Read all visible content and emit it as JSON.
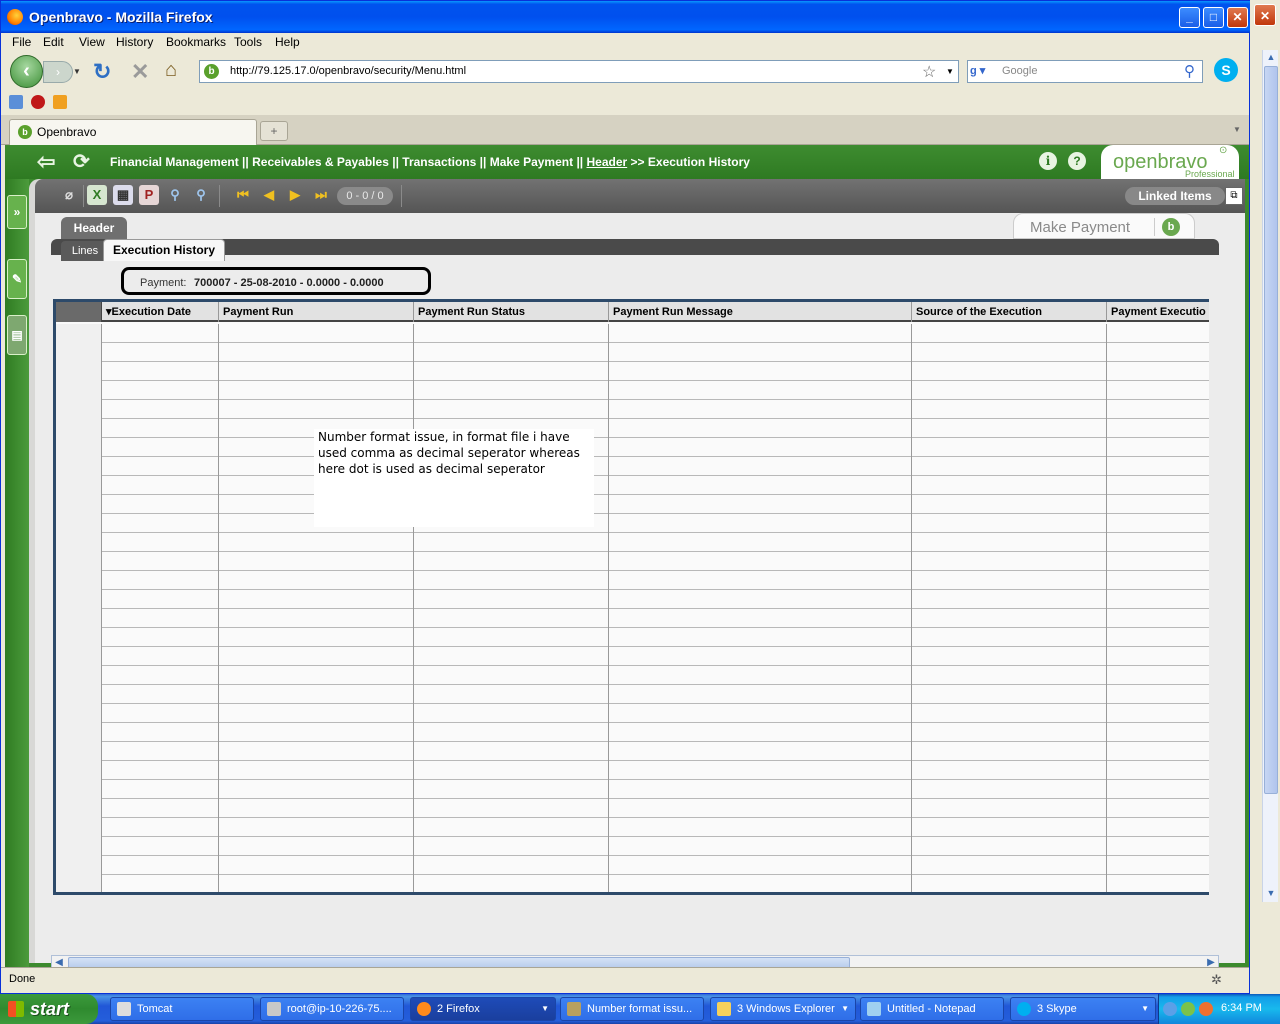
{
  "browser": {
    "title": "Openbravo - Mozilla Firefox",
    "menu": [
      "File",
      "Edit",
      "View",
      "History",
      "Bookmarks",
      "Tools",
      "Help"
    ],
    "url": "http://79.125.17.0/openbravo/security/Menu.html",
    "search_placeholder": "Google",
    "tab_label": "Openbravo",
    "new_tab_symbol": "+",
    "status": "Done"
  },
  "breadcrumb": {
    "part1": "Financial Management",
    "part2": "Receivables & Payables",
    "part3": "Transactions",
    "part4": "Make Payment",
    "header_link": "Header",
    "current": "Execution History",
    "sep": "||",
    "arrow": ">>"
  },
  "logo": {
    "main": "openbravo",
    "sub": "Professional"
  },
  "toolbar": {
    "record_counter": "0 - 0 / 0",
    "linked_items": "Linked Items"
  },
  "window": {
    "header_tab": "Header",
    "title_tab": "Make Payment",
    "subtabs": [
      "Lines",
      "Execution History"
    ]
  },
  "info": {
    "label": "Payment:",
    "value": "700007 - 25-08-2010 - 0.0000 - 0.0000"
  },
  "grid": {
    "columns": [
      "Execution Date",
      "Payment Run",
      "Payment Run Status",
      "Payment Run Message",
      "Source of the Execution",
      "Payment Executio"
    ],
    "sort_column": "Execution Date",
    "row_count": 30
  },
  "annotation": {
    "text": "Number format issue, in format file i have used comma as decimal seperator whereas here dot is used as decimal seperator"
  },
  "taskbar": {
    "start": "start",
    "items": [
      "Tomcat",
      "root@ip-10-226-75....",
      "2 Firefox",
      "Number format issu...",
      "3 Windows Explorer",
      "Untitled - Notepad",
      "3 Skype"
    ],
    "clock": "6:34 PM"
  },
  "colors": {
    "openbravo_green": "#3c8a2e",
    "xp_blue": "#0053ee",
    "grid_border": "#2d4a6a"
  }
}
